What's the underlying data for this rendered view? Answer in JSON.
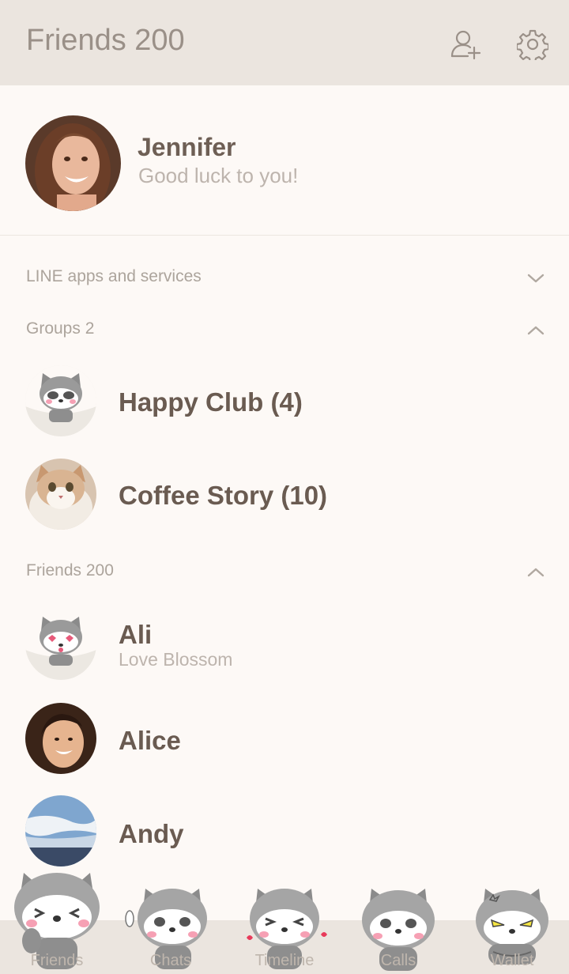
{
  "header": {
    "title": "Friends 200",
    "add_friend_icon": "add-friend-icon",
    "settings_icon": "gear-icon"
  },
  "profile": {
    "name": "Jennifer",
    "status": "Good luck to you!"
  },
  "sections": {
    "services": {
      "label": "LINE apps and services",
      "state": "collapsed"
    },
    "groups": {
      "label": "Groups 2",
      "state": "expanded"
    },
    "friends": {
      "label": "Friends 200",
      "state": "expanded"
    }
  },
  "groups": [
    {
      "name": "Happy Club (4)"
    },
    {
      "name": "Coffee Story (10)"
    }
  ],
  "friends": [
    {
      "name": "Ali",
      "status": "Love Blossom"
    },
    {
      "name": "Alice",
      "status": ""
    },
    {
      "name": "Andy",
      "status": ""
    }
  ],
  "tabs": [
    {
      "label": "Friends",
      "active": true
    },
    {
      "label": "Chats",
      "active": false
    },
    {
      "label": "Timeline",
      "active": false
    },
    {
      "label": "Calls",
      "active": false
    },
    {
      "label": "Wallet",
      "active": false
    }
  ],
  "colors": {
    "header_bg": "#ebe5df",
    "page_bg": "#fdf9f6",
    "text_primary": "#6a5b51",
    "text_muted": "#aca49c"
  }
}
